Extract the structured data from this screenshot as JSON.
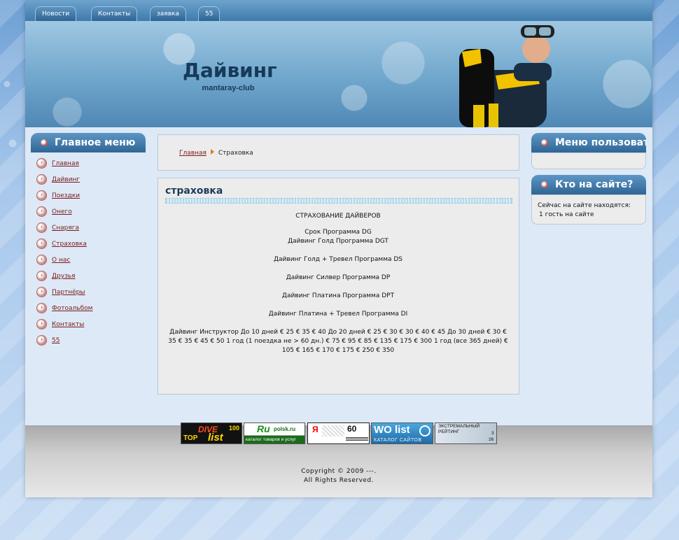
{
  "nav": {
    "tabs": [
      "Новости",
      "Контакты",
      "заявка",
      "55"
    ]
  },
  "header": {
    "title": "Дайвинг",
    "subtitle": "mantaray-club"
  },
  "main_menu": {
    "title": "Главное меню",
    "items": [
      "Главная",
      "Дайвинг",
      "Поездки",
      "Онего",
      "Снаряга",
      "Страховка",
      "О нас",
      "Друзья",
      "Партнёры",
      "Фотоальбом",
      "Контакты",
      "55"
    ]
  },
  "breadcrumb": {
    "home": "Главная",
    "current": "Страховка"
  },
  "article": {
    "title": "страховка",
    "heading": "СТРАХОВАНИЕ ДАЙВЕРОВ",
    "lines": [
      "Срок Программа DG",
      "Дайвинг Голд Программа DGT",
      "Дайвинг Голд + Тревел Программа DS",
      "Дайвинг Силвер Программа DP",
      "Дайвинг Платина Программа DPT",
      "Дайвинг Платина + Тревел Программа DI"
    ],
    "paragraph": "Дайвинг Инструктор До 10 дней € 25 € 35 € 40 До 20 дней € 25 € 30 € 30 € 40 € 45 До 30 дней € 30 € 35 € 35 € 45 € 50 1 год (1 поездка не > 60 дн.) € 75 € 95 € 85 € 135 € 175 € 300 1 год (все 365 дней) € 105 € 165 € 170 € 175 € 250 € 350"
  },
  "user_menu": {
    "title": "Меню пользователя"
  },
  "who_online": {
    "title": "Кто на сайте?",
    "line1": "Сейчас на сайте находятся:",
    "line2": "1 гость на сайте"
  },
  "banners": {
    "dive": {
      "top": "TOP",
      "dive": "DIVE",
      "list": "list",
      "num": "100"
    },
    "polsk": {
      "logo": "Ru",
      "domain": "polsk.ru",
      "caption": "каталог товаров и услуг"
    },
    "yandex": {
      "letter": "Я",
      "num": "60"
    },
    "wolist": {
      "logo": "WO list",
      "caption": "КАТАЛОГ САЙТОВ"
    },
    "extreme": {
      "line1": "ЭКСТРЕМАЛЬНЫЙ",
      "line2": "РЕЙТИНГ",
      "n1": "3",
      "n2": "26"
    }
  },
  "footer": {
    "copyright": "Copyright © 2009 ---.",
    "rights": "All Rights Reserved."
  },
  "colors": {
    "nav_bar": "#3f7bab",
    "link": "#7a1a1a",
    "title": "#173a5a"
  }
}
